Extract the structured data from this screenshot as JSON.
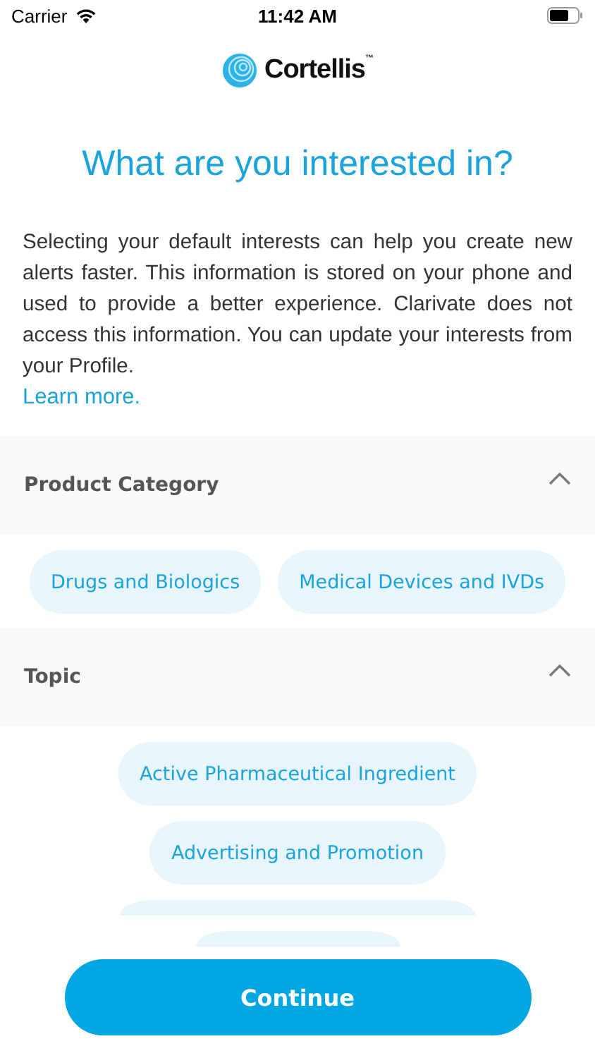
{
  "status_bar": {
    "carrier": "Carrier",
    "time": "11:42 AM"
  },
  "logo": {
    "name": "Cortellis",
    "mark": "™"
  },
  "title": "What are you interested in?",
  "intro": "Selecting your default interests can help you create new alerts faster. This information is stored on your phone and used to provide a better experience. Clarivate does not access this information. You can update your interests from your Profile.",
  "learn_more": "Learn more.",
  "sections": [
    {
      "title": "Product Category",
      "expanded": true,
      "chips": [
        {
          "kind": "chip",
          "label": "Drugs and Biologics",
          "selected": false
        },
        {
          "kind": "chip",
          "label": "Medical Devices and IVDs",
          "selected": false
        }
      ]
    },
    {
      "title": "Topic",
      "expanded": true,
      "chips": [
        {
          "kind": "chip",
          "label": "Active Pharmaceutical Ingredient",
          "selected": false
        },
        {
          "kind": "chip",
          "label": "Advertising and Promotion",
          "selected": false
        },
        {
          "kind": "cut"
        },
        {
          "kind": "cut"
        }
      ]
    }
  ],
  "continue_button": "Continue"
}
